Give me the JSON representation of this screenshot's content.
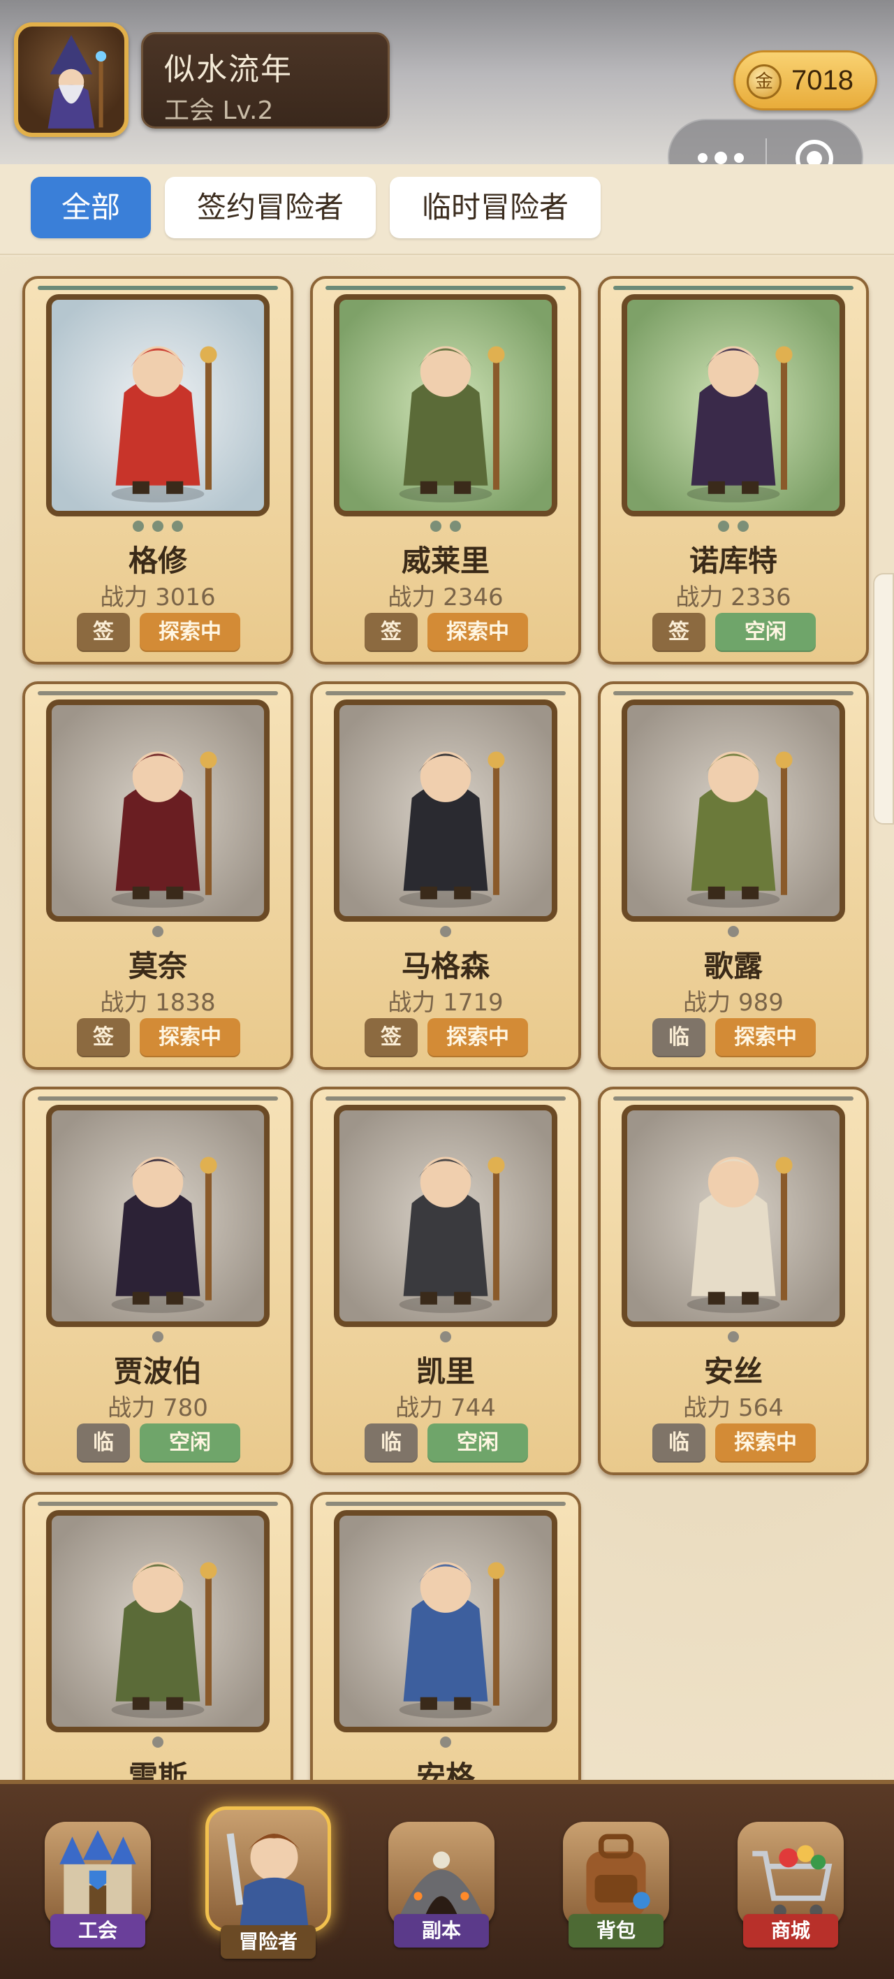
{
  "header": {
    "guild_name": "似水流年",
    "guild_level": "工会 Lv.2",
    "gold_icon_char": "金",
    "gold_value": "7018",
    "avatar_icon": "wizard-avatar-icon"
  },
  "mini_program": {
    "more_icon": "more-dots-icon",
    "close_icon": "target-circle-icon"
  },
  "tabs": [
    {
      "label": "全部",
      "active": true
    },
    {
      "label": "签约冒险者",
      "active": false
    },
    {
      "label": "临时冒险者",
      "active": false
    }
  ],
  "adventurers": [
    {
      "name": "格修",
      "power": "战力 3016",
      "type": "签",
      "status": "探索中",
      "bg": "blue",
      "dots": 3,
      "color": "#c8342a"
    },
    {
      "name": "威莱里",
      "power": "战力 2346",
      "type": "签",
      "status": "探索中",
      "bg": "green",
      "dots": 2,
      "color": "#5b6b38"
    },
    {
      "name": "诺库特",
      "power": "战力 2336",
      "type": "签",
      "status": "空闲",
      "bg": "green",
      "dots": 2,
      "color": "#3a2a4a"
    },
    {
      "name": "莫奈",
      "power": "战力 1838",
      "type": "签",
      "status": "探索中",
      "bg": "stone",
      "dots": 1,
      "color": "#6a1e22"
    },
    {
      "name": "马格森",
      "power": "战力 1719",
      "type": "签",
      "status": "探索中",
      "bg": "stone",
      "dots": 1,
      "color": "#2a2a30"
    },
    {
      "name": "歌露",
      "power": "战力 989",
      "type": "临",
      "status": "探索中",
      "bg": "stone",
      "dots": 1,
      "color": "#6b7a3a"
    },
    {
      "name": "贾波伯",
      "power": "战力 780",
      "type": "临",
      "status": "空闲",
      "bg": "stone",
      "dots": 1,
      "color": "#2c2236"
    },
    {
      "name": "凯里",
      "power": "战力 744",
      "type": "临",
      "status": "空闲",
      "bg": "stone",
      "dots": 1,
      "color": "#3a3a3e"
    },
    {
      "name": "安丝",
      "power": "战力 564",
      "type": "临",
      "status": "探索中",
      "bg": "stone",
      "dots": 1,
      "color": "#e6dcc8"
    },
    {
      "name": "雷斯",
      "power": "",
      "type": "",
      "status": "",
      "bg": "stone",
      "dots": 1,
      "color": "#5b6b38"
    },
    {
      "name": "安格",
      "power": "",
      "type": "",
      "status": "",
      "bg": "stone",
      "dots": 1,
      "color": "#3d5f9e"
    }
  ],
  "nav": [
    {
      "label": "工会",
      "icon": "castle-icon",
      "color": "#6a3f9a",
      "active": false
    },
    {
      "label": "冒险者",
      "icon": "hero-icon",
      "color": "#6b4a25",
      "active": true
    },
    {
      "label": "副本",
      "icon": "dungeon-icon",
      "color": "#5b3a8a",
      "active": false
    },
    {
      "label": "背包",
      "icon": "backpack-icon",
      "color": "#4d6a34",
      "active": false
    },
    {
      "label": "商城",
      "icon": "shop-cart-icon",
      "color": "#b8302a",
      "active": false
    }
  ]
}
